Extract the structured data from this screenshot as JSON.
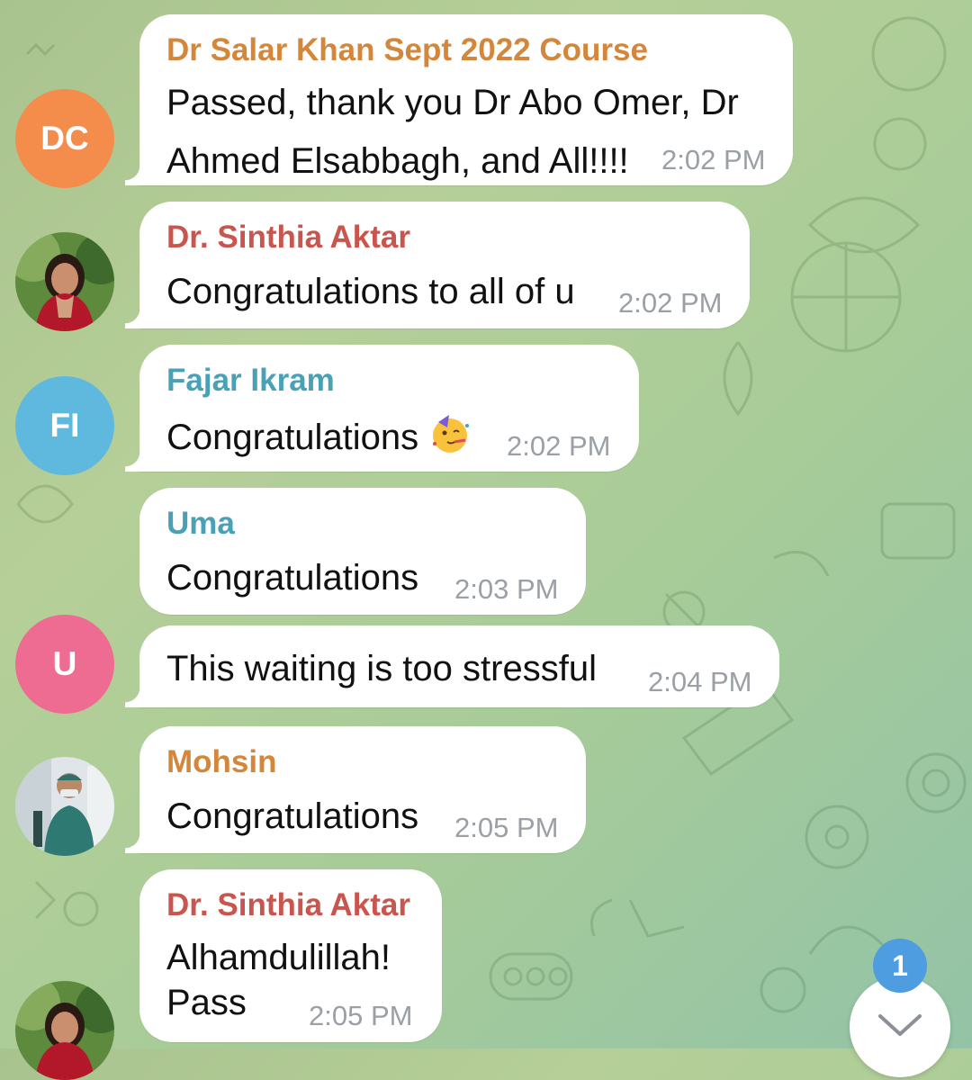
{
  "colors": {
    "sender_orange": "#d4873a",
    "sender_red": "#c8564e",
    "sender_teal": "#4aa0b5",
    "avatar_orange": "#f48c4c",
    "avatar_blue": "#5fb8de",
    "avatar_pink": "#ee6b92",
    "badge_blue": "#4d9de0"
  },
  "messages": [
    {
      "sender": "Dr Salar Khan Sept 2022 Course",
      "text_line1": "Passed, thank you Dr Abo Omer, Dr",
      "text_line2": "Ahmed Elsabbagh, and All!!!!",
      "time": "2:02 PM",
      "avatar_initials": "DC"
    },
    {
      "sender": "Dr. Sinthia Aktar",
      "text": "Congratulations to all of u",
      "time": "2:02 PM",
      "avatar": "profile-photo"
    },
    {
      "sender": "Fajar Ikram",
      "text": "Congratulations",
      "emoji": "partying-face",
      "time": "2:02 PM",
      "avatar_initials": "FI"
    },
    {
      "sender": "Uma",
      "text": "Congratulations",
      "time": "2:03 PM"
    },
    {
      "text": "This waiting is too stressful",
      "time": "2:04 PM",
      "avatar_initials": "U"
    },
    {
      "sender": "Mohsin",
      "text": "Congratulations",
      "time": "2:05 PM",
      "avatar": "profile-photo"
    },
    {
      "sender": "Dr. Sinthia Aktar",
      "text_line1": "Alhamdulillah!",
      "text_line2": "Pass",
      "time": "2:05 PM",
      "avatar": "profile-photo"
    }
  ],
  "scroll_down": {
    "unread_count": "1",
    "icon": "chevron-down-icon"
  }
}
